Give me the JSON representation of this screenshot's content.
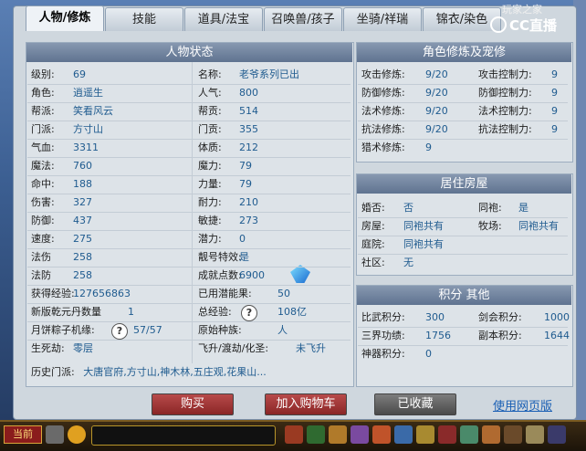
{
  "tabs": [
    "人物/修炼",
    "技能",
    "道具/法宝",
    "召唤兽/孩子",
    "坐骑/祥瑞",
    "锦衣/染色",
    "玩家之家"
  ],
  "watermark": "CC直播",
  "left_header": "人物状态",
  "left_rows": [
    {
      "l1": "级别:",
      "v1": "69",
      "l2": "名称:",
      "v2": "老爷系列已出"
    },
    {
      "l1": "角色:",
      "v1": "逍遥生",
      "l2": "人气:",
      "v2": "800"
    },
    {
      "l1": "帮派:",
      "v1": "笑看风云",
      "l2": "帮贡:",
      "v2": "514"
    },
    {
      "l1": "门派:",
      "v1": "方寸山",
      "l2": "门贡:",
      "v2": "355"
    },
    {
      "l1": "气血:",
      "v1": "3311",
      "l2": "体质:",
      "v2": "212"
    },
    {
      "l1": "魔法:",
      "v1": "760",
      "l2": "魔力:",
      "v2": "79"
    },
    {
      "l1": "命中:",
      "v1": "188",
      "l2": "力量:",
      "v2": "79"
    },
    {
      "l1": "伤害:",
      "v1": "327",
      "l2": "耐力:",
      "v2": "210"
    },
    {
      "l1": "防御:",
      "v1": "437",
      "l2": "敏捷:",
      "v2": "273"
    },
    {
      "l1": "速度:",
      "v1": "275",
      "l2": "潜力:",
      "v2": "0"
    },
    {
      "l1": "法伤",
      "v1": "258",
      "l2": "靓号特效:",
      "v2": "是"
    },
    {
      "l1": "法防",
      "v1": "258",
      "l2": "成就点数:",
      "v2": "6900"
    },
    {
      "l1": "获得经验:",
      "v1": "127656863",
      "l2": "已用潜能果:",
      "v2": "50"
    },
    {
      "l1": "新版乾元丹数量",
      "v1": "1",
      "l2": "总经验:",
      "v2": "108亿"
    },
    {
      "l1": "月饼粽子机缘:",
      "v1": "57/57",
      "l2": "原始种族:",
      "v2": "人"
    },
    {
      "l1": "生死劫:",
      "v1": "零层",
      "l2": "飞升/渡劫/化圣:",
      "v2": "未飞升"
    }
  ],
  "history": {
    "label": "历史门派:",
    "value": "大唐官府,方寸山,神木林,五庄观,花果山..."
  },
  "cult_header": "角色修炼及宠修",
  "cult_rows": [
    {
      "l1": "攻击修炼:",
      "v1": "9/20",
      "l2": "攻击控制力:",
      "v2": "9"
    },
    {
      "l1": "防御修炼:",
      "v1": "9/20",
      "l2": "防御控制力:",
      "v2": "9"
    },
    {
      "l1": "法术修炼:",
      "v1": "9/20",
      "l2": "法术控制力:",
      "v2": "9"
    },
    {
      "l1": "抗法修炼:",
      "v1": "9/20",
      "l2": "抗法控制力:",
      "v2": "9"
    },
    {
      "l1": "猎术修炼:",
      "v1": "9",
      "l2": "",
      "v2": ""
    }
  ],
  "house_header": "居住房屋",
  "house_rows": [
    {
      "l1": "婚否:",
      "v1": "否",
      "l2": "同袍:",
      "v2": "是"
    },
    {
      "l1": "房屋:",
      "v1": "同袍共有",
      "l2": "牧场:",
      "v2": "同袍共有"
    },
    {
      "l1": "庭院:",
      "v1": "同袍共有",
      "l2": "",
      "v2": ""
    },
    {
      "l1": "社区:",
      "v1": "无",
      "l2": "",
      "v2": ""
    }
  ],
  "score_header": "积分 其他",
  "score_rows": [
    {
      "l1": "比武积分:",
      "v1": "300",
      "l2": "剑会积分:",
      "v2": "1000"
    },
    {
      "l1": "三界功绩:",
      "v1": "1756",
      "l2": "副本积分:",
      "v2": "1644"
    },
    {
      "l1": "神器积分:",
      "v1": "0",
      "l2": "",
      "v2": ""
    }
  ],
  "buttons": {
    "buy": "购买",
    "cart": "加入购物车",
    "fav": "已收藏",
    "web": "使用网页版"
  },
  "bottom": {
    "current": "当前"
  }
}
